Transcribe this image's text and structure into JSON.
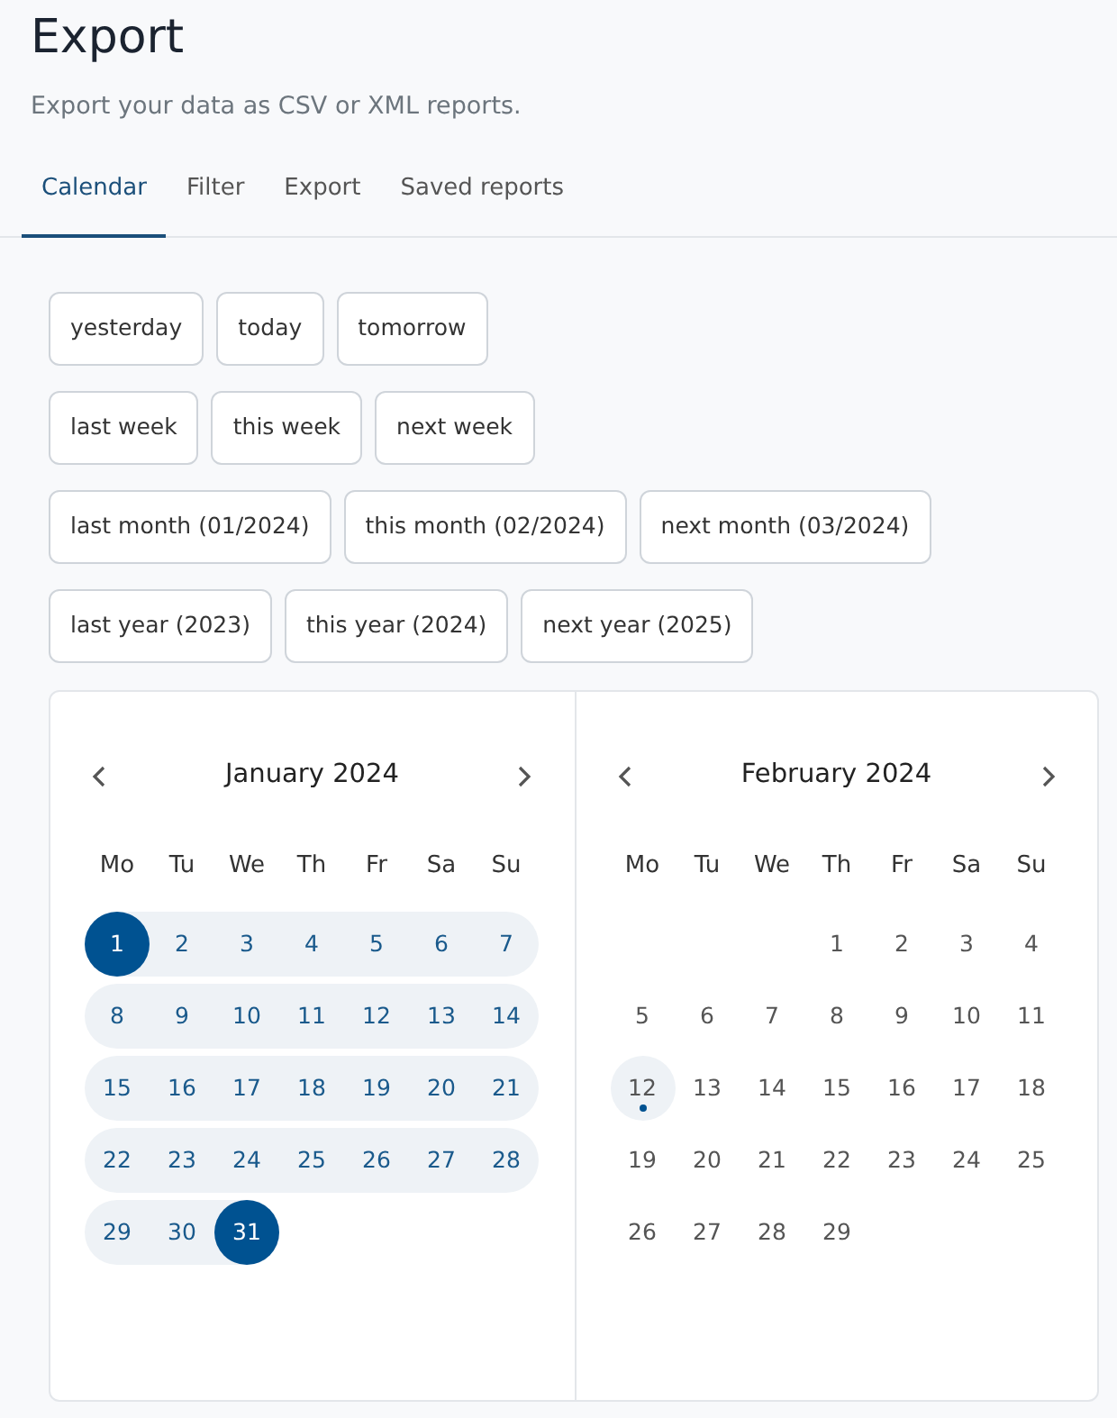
{
  "title": "Export",
  "subtitle": "Export your data as CSV or XML reports.",
  "tabs": [
    {
      "label": "Calendar",
      "selected": true
    },
    {
      "label": "Filter",
      "selected": false
    },
    {
      "label": "Export",
      "selected": false
    },
    {
      "label": "Saved reports",
      "selected": false
    }
  ],
  "preset_rows": [
    [
      "yesterday",
      "today",
      "tomorrow"
    ],
    [
      "last week",
      "this week",
      "next week"
    ],
    [
      "last month (01/2024)",
      "this month (02/2024)",
      "next month (03/2024)"
    ],
    [
      "last year (2023)",
      "this year (2024)",
      "next year (2025)"
    ]
  ],
  "months": [
    {
      "title": "January 2024",
      "weekdays": [
        "Mo",
        "Tu",
        "We",
        "Th",
        "Fr",
        "Sa",
        "Su"
      ],
      "weeks": [
        [
          {
            "kind": "day",
            "label": "1",
            "in_range": true,
            "selected": true,
            "today": false
          },
          {
            "kind": "day",
            "label": "2",
            "in_range": true,
            "selected": false,
            "today": false
          },
          {
            "kind": "day",
            "label": "3",
            "in_range": true,
            "selected": false,
            "today": false
          },
          {
            "kind": "day",
            "label": "4",
            "in_range": true,
            "selected": false,
            "today": false
          },
          {
            "kind": "day",
            "label": "5",
            "in_range": true,
            "selected": false,
            "today": false
          },
          {
            "kind": "day",
            "label": "6",
            "in_range": true,
            "selected": false,
            "today": false
          },
          {
            "kind": "day",
            "label": "7",
            "in_range": true,
            "selected": false,
            "today": false
          }
        ],
        [
          {
            "kind": "day",
            "label": "8",
            "in_range": true,
            "selected": false,
            "today": false
          },
          {
            "kind": "day",
            "label": "9",
            "in_range": true,
            "selected": false,
            "today": false
          },
          {
            "kind": "day",
            "label": "10",
            "in_range": true,
            "selected": false,
            "today": false
          },
          {
            "kind": "day",
            "label": "11",
            "in_range": true,
            "selected": false,
            "today": false
          },
          {
            "kind": "day",
            "label": "12",
            "in_range": true,
            "selected": false,
            "today": false
          },
          {
            "kind": "day",
            "label": "13",
            "in_range": true,
            "selected": false,
            "today": false
          },
          {
            "kind": "day",
            "label": "14",
            "in_range": true,
            "selected": false,
            "today": false
          }
        ],
        [
          {
            "kind": "day",
            "label": "15",
            "in_range": true,
            "selected": false,
            "today": false
          },
          {
            "kind": "day",
            "label": "16",
            "in_range": true,
            "selected": false,
            "today": false
          },
          {
            "kind": "day",
            "label": "17",
            "in_range": true,
            "selected": false,
            "today": false
          },
          {
            "kind": "day",
            "label": "18",
            "in_range": true,
            "selected": false,
            "today": false
          },
          {
            "kind": "day",
            "label": "19",
            "in_range": true,
            "selected": false,
            "today": false
          },
          {
            "kind": "day",
            "label": "20",
            "in_range": true,
            "selected": false,
            "today": false
          },
          {
            "kind": "day",
            "label": "21",
            "in_range": true,
            "selected": false,
            "today": false
          }
        ],
        [
          {
            "kind": "day",
            "label": "22",
            "in_range": true,
            "selected": false,
            "today": false
          },
          {
            "kind": "day",
            "label": "23",
            "in_range": true,
            "selected": false,
            "today": false
          },
          {
            "kind": "day",
            "label": "24",
            "in_range": true,
            "selected": false,
            "today": false
          },
          {
            "kind": "day",
            "label": "25",
            "in_range": true,
            "selected": false,
            "today": false
          },
          {
            "kind": "day",
            "label": "26",
            "in_range": true,
            "selected": false,
            "today": false
          },
          {
            "kind": "day",
            "label": "27",
            "in_range": true,
            "selected": false,
            "today": false
          },
          {
            "kind": "day",
            "label": "28",
            "in_range": true,
            "selected": false,
            "today": false
          }
        ],
        [
          {
            "kind": "day",
            "label": "29",
            "in_range": true,
            "selected": false,
            "today": false
          },
          {
            "kind": "day",
            "label": "30",
            "in_range": true,
            "selected": false,
            "today": false
          },
          {
            "kind": "day",
            "label": "31",
            "in_range": true,
            "selected": true,
            "today": false
          }
        ]
      ]
    },
    {
      "title": "February 2024",
      "weekdays": [
        "Mo",
        "Tu",
        "We",
        "Th",
        "Fr",
        "Sa",
        "Su"
      ],
      "weeks": [
        [
          {
            "kind": "blank"
          },
          {
            "kind": "blank"
          },
          {
            "kind": "blank"
          },
          {
            "kind": "day",
            "label": "1",
            "in_range": false,
            "selected": false,
            "today": false
          },
          {
            "kind": "day",
            "label": "2",
            "in_range": false,
            "selected": false,
            "today": false
          },
          {
            "kind": "day",
            "label": "3",
            "in_range": false,
            "selected": false,
            "today": false
          },
          {
            "kind": "day",
            "label": "4",
            "in_range": false,
            "selected": false,
            "today": false
          }
        ],
        [
          {
            "kind": "day",
            "label": "5",
            "in_range": false,
            "selected": false,
            "today": false
          },
          {
            "kind": "day",
            "label": "6",
            "in_range": false,
            "selected": false,
            "today": false
          },
          {
            "kind": "day",
            "label": "7",
            "in_range": false,
            "selected": false,
            "today": false
          },
          {
            "kind": "day",
            "label": "8",
            "in_range": false,
            "selected": false,
            "today": false
          },
          {
            "kind": "day",
            "label": "9",
            "in_range": false,
            "selected": false,
            "today": false
          },
          {
            "kind": "day",
            "label": "10",
            "in_range": false,
            "selected": false,
            "today": false
          },
          {
            "kind": "day",
            "label": "11",
            "in_range": false,
            "selected": false,
            "today": false
          }
        ],
        [
          {
            "kind": "day",
            "label": "12",
            "in_range": false,
            "selected": false,
            "today": true
          },
          {
            "kind": "day",
            "label": "13",
            "in_range": false,
            "selected": false,
            "today": false
          },
          {
            "kind": "day",
            "label": "14",
            "in_range": false,
            "selected": false,
            "today": false
          },
          {
            "kind": "day",
            "label": "15",
            "in_range": false,
            "selected": false,
            "today": false
          },
          {
            "kind": "day",
            "label": "16",
            "in_range": false,
            "selected": false,
            "today": false
          },
          {
            "kind": "day",
            "label": "17",
            "in_range": false,
            "selected": false,
            "today": false
          },
          {
            "kind": "day",
            "label": "18",
            "in_range": false,
            "selected": false,
            "today": false
          }
        ],
        [
          {
            "kind": "day",
            "label": "19",
            "in_range": false,
            "selected": false,
            "today": false
          },
          {
            "kind": "day",
            "label": "20",
            "in_range": false,
            "selected": false,
            "today": false
          },
          {
            "kind": "day",
            "label": "21",
            "in_range": false,
            "selected": false,
            "today": false
          },
          {
            "kind": "day",
            "label": "22",
            "in_range": false,
            "selected": false,
            "today": false
          },
          {
            "kind": "day",
            "label": "23",
            "in_range": false,
            "selected": false,
            "today": false
          },
          {
            "kind": "day",
            "label": "24",
            "in_range": false,
            "selected": false,
            "today": false
          },
          {
            "kind": "day",
            "label": "25",
            "in_range": false,
            "selected": false,
            "today": false
          }
        ],
        [
          {
            "kind": "day",
            "label": "26",
            "in_range": false,
            "selected": false,
            "today": false
          },
          {
            "kind": "day",
            "label": "27",
            "in_range": false,
            "selected": false,
            "today": false
          },
          {
            "kind": "day",
            "label": "28",
            "in_range": false,
            "selected": false,
            "today": false
          },
          {
            "kind": "day",
            "label": "29",
            "in_range": false,
            "selected": false,
            "today": false
          }
        ]
      ]
    }
  ]
}
